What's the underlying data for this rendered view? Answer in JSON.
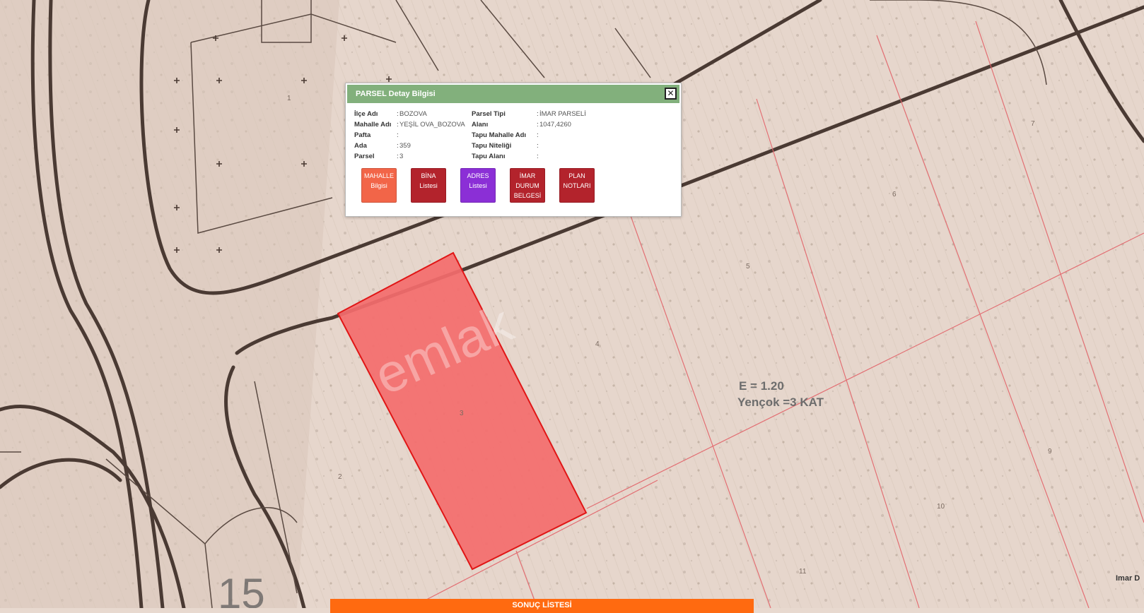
{
  "map": {
    "watermark": "emlak",
    "zoning_text": {
      "line1": "E = 1.20",
      "line2": "Yençok =3 KAT"
    },
    "parcel_numbers": [
      "1",
      "2",
      "3",
      "4",
      "5",
      "6",
      "7",
      "9",
      "10",
      "11"
    ],
    "scale_text": "15",
    "corner_text": "Imar D"
  },
  "popup": {
    "title": "PARSEL Detay Bilgisi",
    "close_glyph": "✕",
    "left_fields": [
      {
        "label": "İlçe Adı",
        "value": "BOZOVA"
      },
      {
        "label": "Mahalle Adı",
        "value": "YEŞİL OVA_BOZOVA"
      },
      {
        "label": "Pafta",
        "value": ""
      },
      {
        "label": "Ada",
        "value": "359"
      },
      {
        "label": "Parsel",
        "value": "3"
      }
    ],
    "right_fields": [
      {
        "label": "Parsel Tipi",
        "value": "İMAR PARSELİ"
      },
      {
        "label": "Alanı",
        "value": "1047,4260"
      },
      {
        "label": "Tapu Mahalle Adı",
        "value": ""
      },
      {
        "label": "Tapu Niteliği",
        "value": ""
      },
      {
        "label": "Tapu Alanı",
        "value": ""
      }
    ],
    "buttons": [
      {
        "label": "MAHALLE Bilgisi",
        "color": "#f26548"
      },
      {
        "label": "BİNA Listesi",
        "color": "#b3232c"
      },
      {
        "label": "ADRES Listesi",
        "color": "#8b2fd6"
      },
      {
        "label": "İMAR DURUM BELGESİ",
        "color": "#b3232c"
      },
      {
        "label": "PLAN NOTLARI",
        "color": "#b3232c"
      }
    ]
  },
  "bottom_bar": {
    "label": "SONUÇ LİSTESİ",
    "color": "#ff6a10"
  },
  "colors": {
    "parcel_fill": "#f46d6d",
    "parcel_border": "#e01616",
    "header": "#82b07c"
  }
}
